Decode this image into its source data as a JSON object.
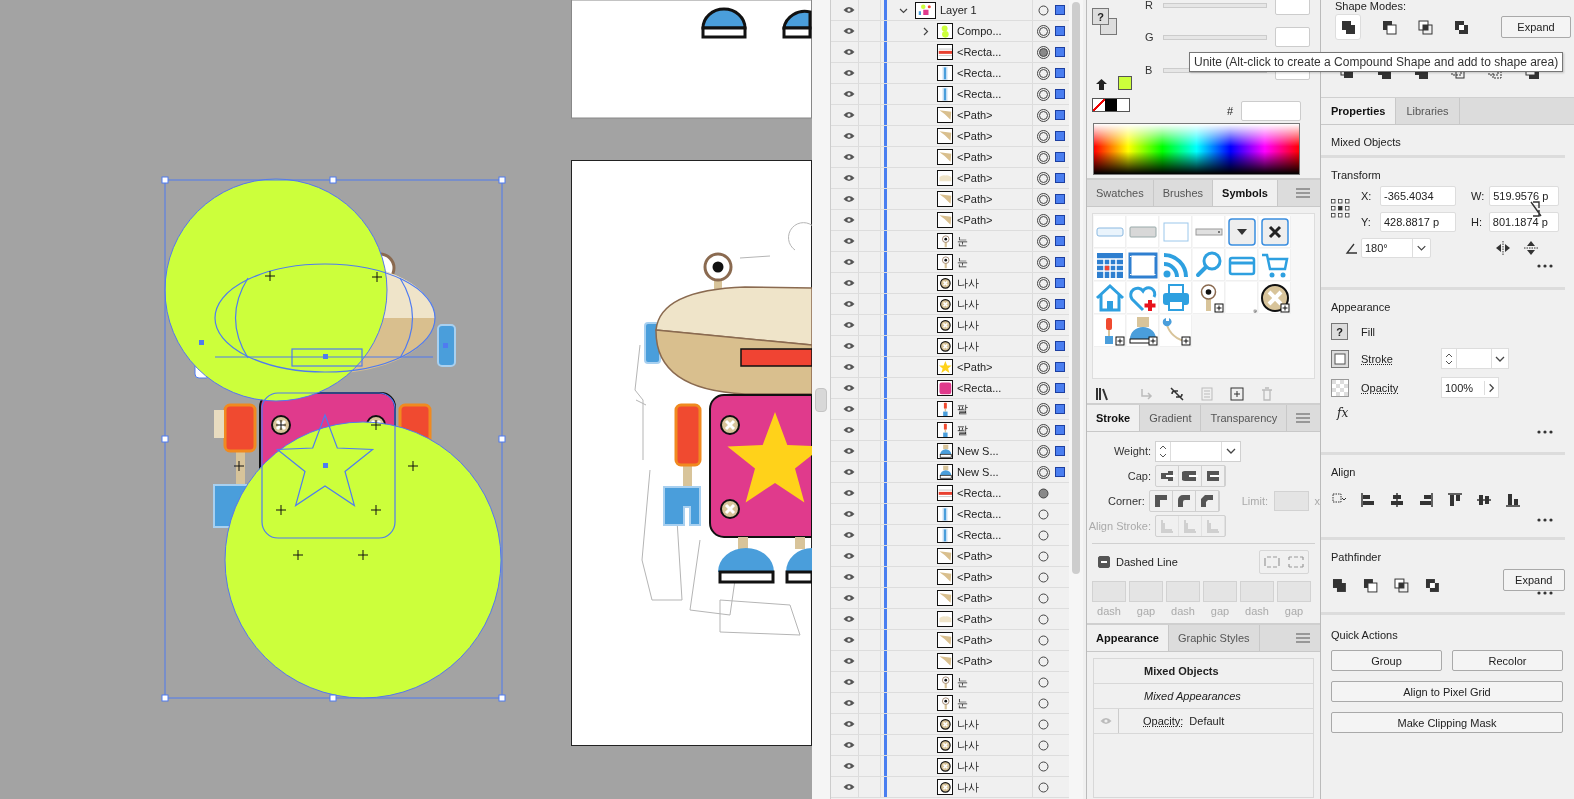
{
  "layers": {
    "layer": {
      "name": "Layer 1",
      "kind": "layer",
      "expanded": true,
      "selected": true,
      "children": [
        {
          "name": "Compo...",
          "kind": "compound",
          "expanded": false,
          "selected": true,
          "appearance": false
        },
        {
          "name": "<Recta...",
          "kind": "red-bar",
          "selected": true,
          "appearance": true
        },
        {
          "name": "<Recta...",
          "kind": "blue-bar",
          "selected": true,
          "appearance": false
        },
        {
          "name": "<Recta...",
          "kind": "blue-bar",
          "selected": true,
          "appearance": false
        },
        {
          "name": "<Path>",
          "kind": "tan-path",
          "selected": true,
          "appearance": false
        },
        {
          "name": "<Path>",
          "kind": "tan-path",
          "selected": true,
          "appearance": false
        },
        {
          "name": "<Path>",
          "kind": "tan-path",
          "selected": true,
          "appearance": false
        },
        {
          "name": "<Path>",
          "kind": "light-path",
          "selected": true,
          "appearance": false
        },
        {
          "name": "<Path>",
          "kind": "tan-path",
          "selected": true,
          "appearance": false
        },
        {
          "name": "<Path>",
          "kind": "tan-path",
          "selected": true,
          "appearance": false
        },
        {
          "name": "눈",
          "kind": "eye",
          "selected": true,
          "appearance": false
        },
        {
          "name": "눈",
          "kind": "eye",
          "selected": true,
          "appearance": false
        },
        {
          "name": "나사",
          "kind": "screw",
          "selected": true,
          "appearance": false
        },
        {
          "name": "나사",
          "kind": "screw",
          "selected": true,
          "appearance": false
        },
        {
          "name": "나사",
          "kind": "screw",
          "selected": true,
          "appearance": false
        },
        {
          "name": "나사",
          "kind": "screw",
          "selected": true,
          "appearance": false
        },
        {
          "name": "<Path>",
          "kind": "star",
          "selected": true,
          "appearance": false
        },
        {
          "name": "<Recta...",
          "kind": "pink-rect",
          "selected": true,
          "appearance": false
        },
        {
          "name": "팔",
          "kind": "arm",
          "selected": true,
          "appearance": false
        },
        {
          "name": "팔",
          "kind": "arm",
          "selected": true,
          "appearance": false
        },
        {
          "name": "New S...",
          "kind": "foot",
          "selected": true,
          "appearance": false
        },
        {
          "name": "New S...",
          "kind": "foot",
          "selected": true,
          "appearance": false
        },
        {
          "name": "<Recta...",
          "kind": "red-bar",
          "selected": false,
          "appearance": true
        },
        {
          "name": "<Recta...",
          "kind": "blue-bar",
          "selected": false,
          "appearance": false
        },
        {
          "name": "<Recta...",
          "kind": "blue-bar",
          "selected": false,
          "appearance": false
        },
        {
          "name": "<Path>",
          "kind": "tan-path",
          "selected": false,
          "appearance": false
        },
        {
          "name": "<Path>",
          "kind": "tan-path",
          "selected": false,
          "appearance": false
        },
        {
          "name": "<Path>",
          "kind": "tan-path",
          "selected": false,
          "appearance": false
        },
        {
          "name": "<Path>",
          "kind": "light-path",
          "selected": false,
          "appearance": false
        },
        {
          "name": "<Path>",
          "kind": "tan-path",
          "selected": false,
          "appearance": false
        },
        {
          "name": "<Path>",
          "kind": "tan-path",
          "selected": false,
          "appearance": false
        },
        {
          "name": "눈",
          "kind": "eye",
          "selected": false,
          "appearance": false
        },
        {
          "name": "눈",
          "kind": "eye",
          "selected": false,
          "appearance": false
        },
        {
          "name": "나사",
          "kind": "screw",
          "selected": false,
          "appearance": false
        },
        {
          "name": "나사",
          "kind": "screw",
          "selected": false,
          "appearance": false
        },
        {
          "name": "나사",
          "kind": "screw",
          "selected": false,
          "appearance": false
        },
        {
          "name": "나사",
          "kind": "screw",
          "selected": false,
          "appearance": false
        }
      ]
    }
  },
  "color_panel": {
    "fill_mark": "?",
    "channels": [
      {
        "label": "R",
        "level": 0
      },
      {
        "label": "G",
        "level": 0
      },
      {
        "label": "B",
        "level": 0
      }
    ],
    "hex_label": "#"
  },
  "symbols_panel": {
    "tabs": [
      {
        "label": "Swatches",
        "selected": false
      },
      {
        "label": "Brushes",
        "selected": false
      },
      {
        "label": "Symbols",
        "selected": true
      }
    ],
    "symbols": [
      {
        "kind": "flat-button"
      },
      {
        "kind": "gray-button"
      },
      {
        "kind": "text-box"
      },
      {
        "kind": "slider-bar"
      },
      {
        "kind": "dropdown"
      },
      {
        "kind": "close"
      },
      {
        "kind": "calendar"
      },
      {
        "kind": "film"
      },
      {
        "kind": "rss"
      },
      {
        "kind": "search"
      },
      {
        "kind": "card"
      },
      {
        "kind": "cart"
      },
      {
        "kind": "home"
      },
      {
        "kind": "heart"
      },
      {
        "kind": "printer"
      },
      {
        "kind": "eye-stalk"
      },
      {
        "kind": "blank"
      },
      {
        "kind": "screw"
      },
      {
        "kind": "arm"
      },
      {
        "kind": "foot"
      },
      {
        "kind": "cable"
      }
    ]
  },
  "stroke_panel": {
    "tabs": [
      {
        "label": "Stroke",
        "selected": true
      },
      {
        "label": "Gradient",
        "selected": false
      },
      {
        "label": "Transparency",
        "selected": false
      }
    ],
    "weight_label": "Weight:",
    "cap_label": "Cap:",
    "corner_label": "Corner:",
    "limit_label": "Limit:",
    "limit_unit": "x",
    "align_stroke": {
      "label": "Align Stroke:",
      "disabled": true
    },
    "dashed_line": {
      "label": "Dashed Line",
      "indeterminate": true
    },
    "dash_fields": [
      {
        "label": "dash"
      },
      {
        "label": "gap"
      },
      {
        "label": "dash"
      },
      {
        "label": "gap"
      },
      {
        "label": "dash"
      },
      {
        "label": "gap"
      }
    ]
  },
  "appearance_panel": {
    "tabs": [
      {
        "label": "Appearance",
        "selected": true
      },
      {
        "label": "Graphic Styles",
        "selected": false
      }
    ],
    "object_type": "Mixed Objects",
    "appearance": "Mixed Appearances",
    "opacity_label": "Opacity:",
    "opacity_value": "Default"
  },
  "pathfinder_panel": {
    "shape_modes_label": "Shape Modes:",
    "expand_button": "Expand",
    "tooltip": "Unite (Alt-click to create a Compound Shape and add to shape area)"
  },
  "properties": {
    "tabs": [
      {
        "label": "Properties",
        "selected": true
      },
      {
        "label": "Libraries",
        "selected": false
      }
    ],
    "selection_type": "Mixed Objects",
    "transform": {
      "title": "Transform",
      "fields": [
        {
          "label": "X:",
          "value": "-365.4034"
        },
        {
          "label": "W:",
          "value": "519.9576 p"
        },
        {
          "label": "Y:",
          "value": "428.8817 p"
        },
        {
          "label": "H:",
          "value": "801.1874 p"
        }
      ],
      "angle": "180°"
    },
    "appearance": {
      "title": "Appearance",
      "fill_mark": "?",
      "fill_label": "Fill",
      "stroke_label": "Stroke",
      "opacity_label": "Opacity",
      "opacity_value": "100%",
      "fx": "fx"
    },
    "align": {
      "title": "Align"
    },
    "pathfinder": {
      "title": "Pathfinder",
      "expand_button": "Expand"
    },
    "quick_actions": {
      "title": "Quick Actions",
      "buttons": [
        "Group",
        "Recolor",
        "Align to Pixel Grid",
        "Make Clipping Mask"
      ]
    }
  }
}
